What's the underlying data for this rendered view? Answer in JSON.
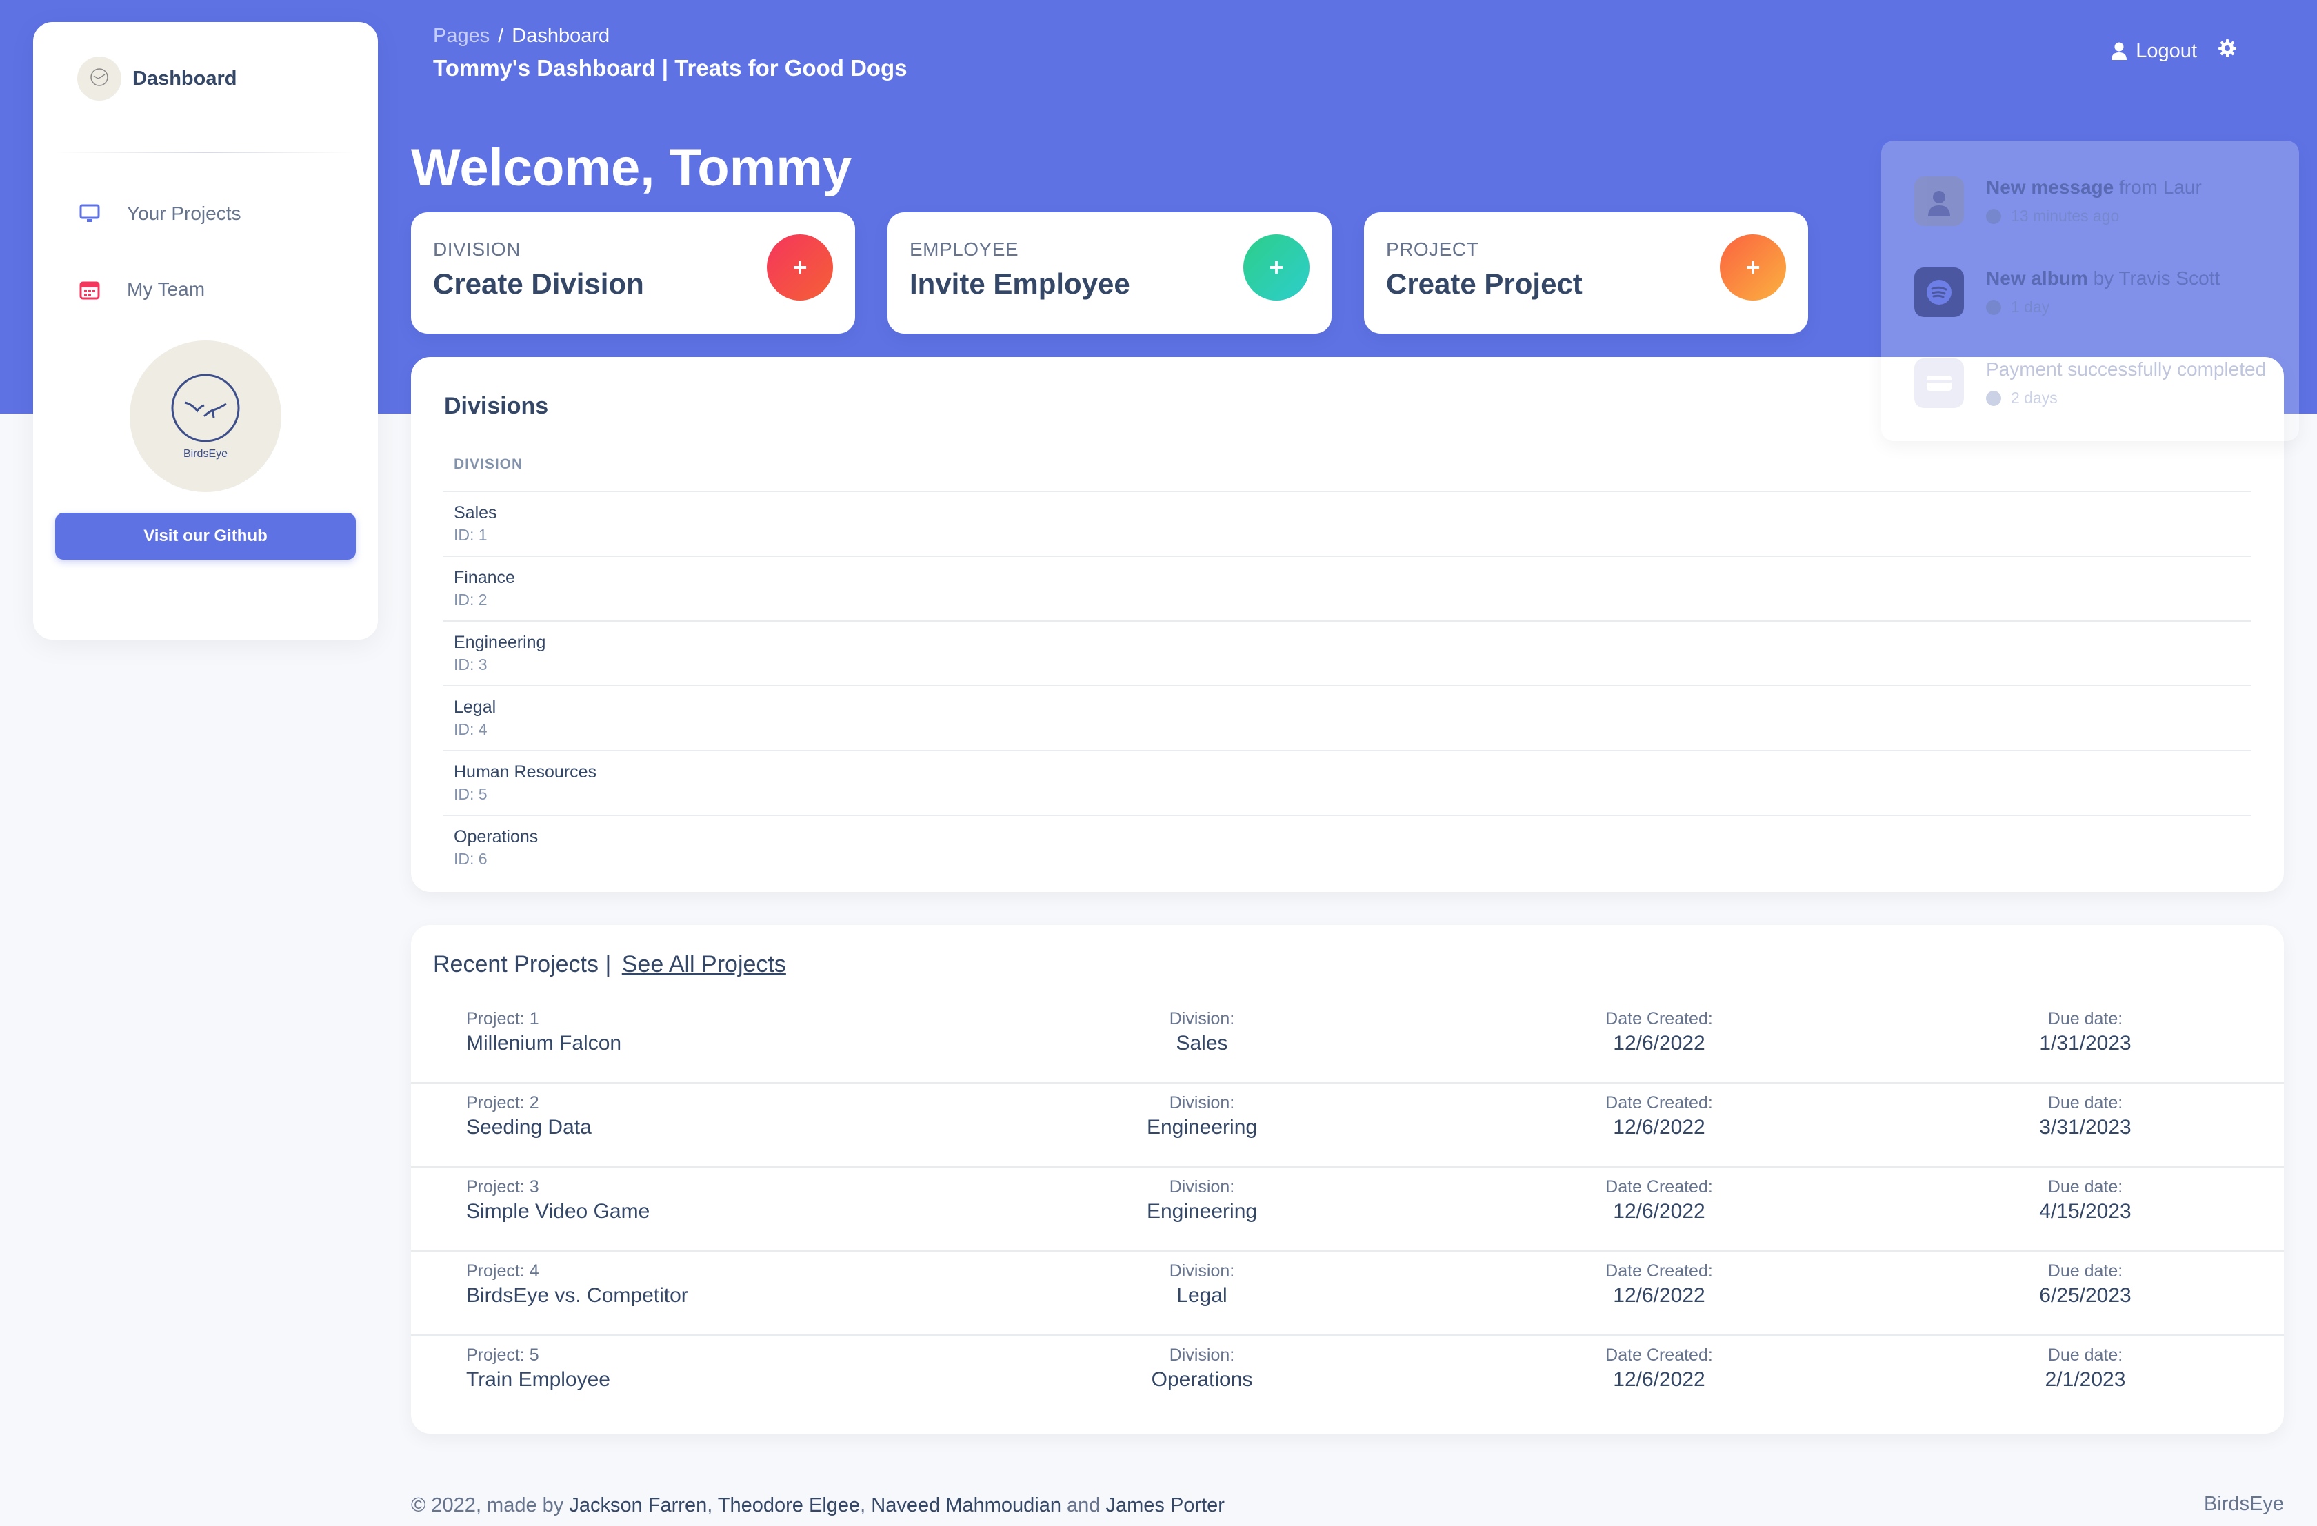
{
  "sidebar": {
    "brand": "Dashboard",
    "logo_icon": "birdseye-logo-icon",
    "items": [
      {
        "label": "Your Projects",
        "icon": "monitor-icon"
      },
      {
        "label": "My Team",
        "icon": "calendar-icon"
      }
    ],
    "avatar_text": "BirdsEye",
    "github_button": "Visit our Github"
  },
  "header": {
    "breadcrumb_root": "Pages",
    "breadcrumb_sep": "/",
    "breadcrumb_current": "Dashboard",
    "title": "Tommy's Dashboard | Treats for Good Dogs",
    "logout": "Logout",
    "settings_icon": "gear-icon"
  },
  "welcome": "Welcome, Tommy",
  "actions": [
    {
      "category": "DIVISION",
      "title": "Create Division",
      "plus": "+",
      "color": "#f5365c"
    },
    {
      "category": "EMPLOYEE",
      "title": "Invite Employee",
      "plus": "+",
      "color": "#2dce89"
    },
    {
      "category": "PROJECT",
      "title": "Create Project",
      "plus": "+",
      "color": "#fb6340"
    }
  ],
  "divisions": {
    "title": "Divisions",
    "column": "DIVISION",
    "rows": [
      {
        "name": "Sales",
        "id": "ID: 1"
      },
      {
        "name": "Finance",
        "id": "ID: 2"
      },
      {
        "name": "Engineering",
        "id": "ID: 3"
      },
      {
        "name": "Legal",
        "id": "ID: 4"
      },
      {
        "name": "Human Resources",
        "id": "ID: 5"
      },
      {
        "name": "Operations",
        "id": "ID: 6"
      }
    ]
  },
  "notifications": [
    {
      "bold": "New message",
      "rest": " from Laur",
      "time": "13 minutes ago",
      "icon": "avatar-icon"
    },
    {
      "bold": "New album",
      "rest": " by Travis Scott",
      "time": "1 day",
      "icon": "spotify-icon"
    },
    {
      "bold": "",
      "rest": "Payment successfully completed",
      "time": "2 days",
      "icon": "credit-card-icon"
    }
  ],
  "projects": {
    "title": "Recent Projects",
    "separator": "|",
    "see_all": "See All Projects",
    "labels": {
      "division": "Division:",
      "created": "Date Created:",
      "due": "Due date:"
    },
    "rows": [
      {
        "num": "Project: 1",
        "name": "Millenium Falcon",
        "division": "Sales",
        "created": "12/6/2022",
        "due": "1/31/2023"
      },
      {
        "num": "Project: 2",
        "name": "Seeding Data",
        "division": "Engineering",
        "created": "12/6/2022",
        "due": "3/31/2023"
      },
      {
        "num": "Project: 3",
        "name": "Simple Video Game",
        "division": "Engineering",
        "created": "12/6/2022",
        "due": "4/15/2023"
      },
      {
        "num": "Project: 4",
        "name": "BirdsEye vs. Competitor",
        "division": "Legal",
        "created": "12/6/2022",
        "due": "6/25/2023"
      },
      {
        "num": "Project: 5",
        "name": "Train Employee",
        "division": "Operations",
        "created": "12/6/2022",
        "due": "2/1/2023"
      }
    ]
  },
  "footer": {
    "prefix": "© 2022, made by ",
    "author1": "Jackson Farren",
    "comma1": ", ",
    "author2": "Theodore Elgee",
    "comma2": ", ",
    "author3": "Naveed Mahmoudian",
    "and": " and ",
    "author4": "James Porter",
    "brand": "BirdsEye"
  },
  "colors": {
    "primary": "#5e72e4",
    "text": "#344767",
    "muted": "#67748e"
  }
}
